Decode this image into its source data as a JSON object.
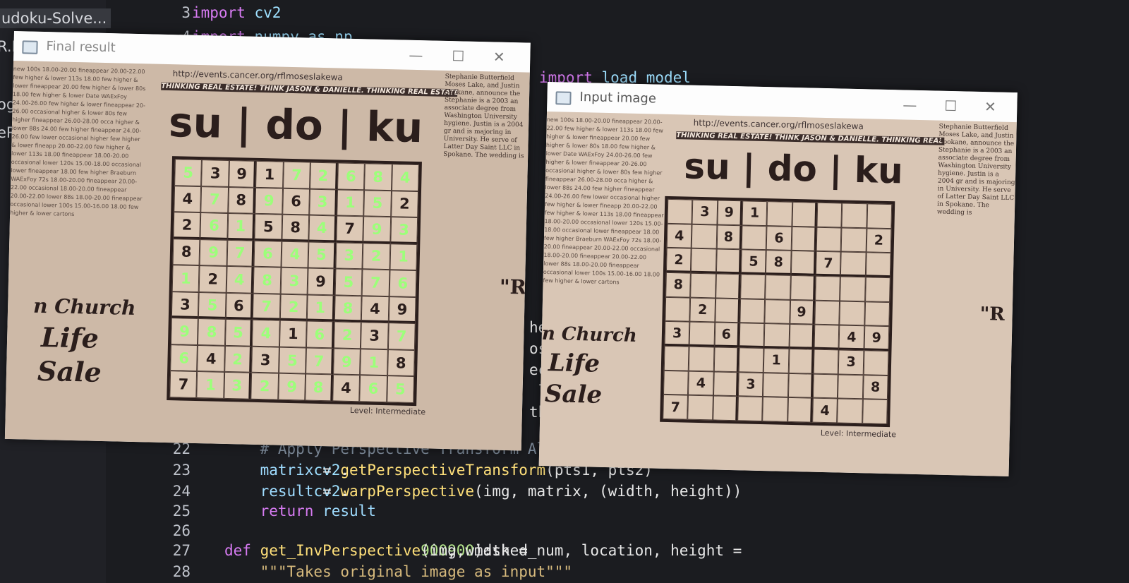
{
  "explorer": {
    "items": [
      "udoku-Solve...",
      "R.H",
      "og",
      "eRu"
    ]
  },
  "code_lines": [
    {
      "n": "3",
      "parts": [
        [
          "kw",
          "import "
        ],
        [
          "mod",
          "cv2"
        ]
      ]
    },
    {
      "n": "4",
      "parts": [
        [
          "kw",
          "import "
        ],
        [
          "mod",
          "numpy as np"
        ]
      ]
    },
    {
      "n": "",
      "parts": [
        [
          "kw",
          "import "
        ],
        [
          "mod",
          "load_model"
        ]
      ]
    },
    {
      "n": "",
      "parts": [
        [
          "code",
          "hei"
        ]
      ]
    },
    {
      "n": "",
      "parts": [
        [
          "code",
          "os"
        ]
      ]
    },
    {
      "n": "",
      "parts": [
        [
          "code",
          "ect"
        ]
      ]
    },
    {
      "n": "",
      "parts": [
        [
          "code",
          " lo"
        ]
      ]
    },
    {
      "n": "",
      "parts": [
        [
          "code",
          "th"
        ]
      ]
    },
    {
      "n": "22",
      "parts": [
        [
          "cm",
          "    # Apply Perspective Transform Algorithm"
        ]
      ]
    },
    {
      "n": "23",
      "parts": [
        [
          "var",
          "    matrix"
        ],
        [
          "code",
          " = "
        ],
        [
          "mod",
          "cv2"
        ],
        [
          "code",
          "."
        ],
        [
          "fn",
          "getPerspectiveTransform"
        ],
        [
          "code",
          "(pts1, pts2)"
        ]
      ]
    },
    {
      "n": "24",
      "parts": [
        [
          "var",
          "    result"
        ],
        [
          "code",
          " = "
        ],
        [
          "mod",
          "cv2"
        ],
        [
          "code",
          "."
        ],
        [
          "fn",
          "warpPerspective"
        ],
        [
          "code",
          "(img, matrix, (width, height))"
        ]
      ]
    },
    {
      "n": "25",
      "parts": [
        [
          "kw",
          "    return "
        ],
        [
          "var",
          "result"
        ]
      ]
    },
    {
      "n": "26",
      "parts": [
        [
          "code",
          ""
        ]
      ]
    },
    {
      "n": "27",
      "parts": [
        [
          "kw",
          "def "
        ],
        [
          "fn",
          "get_InvPerspective"
        ],
        [
          "code",
          "(img, masked_num, location, height = "
        ],
        [
          "num",
          "900"
        ],
        [
          "code",
          ", width = "
        ],
        [
          "num",
          "900"
        ],
        [
          "code",
          "):"
        ]
      ]
    },
    {
      "n": "28",
      "parts": [
        [
          "str",
          "    \"\"\"Takes original image as input\"\"\""
        ]
      ]
    }
  ],
  "final_window": {
    "title": "Final result",
    "url": "http://events.cancer.org/rflmoseslakewa",
    "banner": "THINKING REAL ESTATE! THINK JASON & DANIELLE. THINKING REAL ESTATE! THINK",
    "logo": "su | do | ku",
    "level": "Level: Intermediate",
    "church": [
      "n Church",
      "Life",
      "Sale"
    ],
    "side_text": "Stephanie Butterfield Moses Lake, and Justin Spokane, announce the Stephanie is a 2003 an associate degree from Washington University hygiene. Justin is a 2004 gr and is majoring in University. He serve of Latter Day Saint LLC in Spokane. The wedding is",
    "quote": "\"R",
    "rows": [
      [
        "5g",
        "3",
        "9",
        "1",
        "7g",
        "2g",
        "6g",
        "8g",
        "4g"
      ],
      [
        "4",
        "7g",
        "8",
        "9g",
        "6",
        "3g",
        "1g",
        "5g",
        "2"
      ],
      [
        "2",
        "6g",
        "1g",
        "5",
        "8",
        "4g",
        "7",
        "9g",
        "3g"
      ],
      [
        "8",
        "9g",
        "7g",
        "6g",
        "4g",
        "5g",
        "3g",
        "2g",
        "1g"
      ],
      [
        "1g",
        "2",
        "4g",
        "8g",
        "3g",
        "9",
        "5g",
        "7g",
        "6g"
      ],
      [
        "3",
        "5g",
        "6",
        "7g",
        "2g",
        "1g",
        "8g",
        "4",
        "9"
      ],
      [
        "9g",
        "8g",
        "5g",
        "4g",
        "1",
        "6g",
        "2g",
        "3",
        "7g"
      ],
      [
        "6g",
        "4",
        "2g",
        "3",
        "5g",
        "7g",
        "9g",
        "1g",
        "8"
      ],
      [
        "7",
        "1g",
        "3g",
        "2g",
        "9g",
        "8g",
        "4",
        "6g",
        "5g"
      ]
    ]
  },
  "input_window": {
    "title": "Input image",
    "url": "http://events.cancer.org/rflmoseslakewa",
    "banner": "THINKING REAL ESTATE! THINK JASON & DANIELLE. THINKING REAL ESTATE! THINK",
    "logo": "su | do | ku",
    "level": "Level: Intermediate",
    "church": [
      "n Church",
      "Life",
      "Sale"
    ],
    "side_text": "Stephanie Butterfield Moses Lake, and Justin Spokane, announce the Stephanie is a 2003 an associate degree from Washington University hygiene. Justin is a 2004 gr and is majoring in University. He serve of Latter Day Saint LLC in Spokane. The wedding is",
    "quote": "\"R",
    "rows": [
      [
        "",
        "3",
        "9",
        "1",
        "",
        "",
        "",
        "",
        ""
      ],
      [
        "4",
        "",
        "8",
        "",
        "6",
        "",
        "",
        "",
        "2"
      ],
      [
        "2",
        "",
        "",
        "5",
        "8",
        "",
        "7",
        "",
        ""
      ],
      [
        "8",
        "",
        "",
        "",
        "",
        "",
        "",
        "",
        ""
      ],
      [
        "",
        "2",
        "",
        "",
        "",
        "9",
        "",
        "",
        ""
      ],
      [
        "3",
        "",
        "6",
        "",
        "",
        "",
        "",
        "4",
        "9"
      ],
      [
        "",
        "",
        "",
        "",
        "1",
        "",
        "",
        "3",
        ""
      ],
      [
        "",
        "4",
        "",
        "3",
        "",
        "",
        "",
        "",
        "8"
      ],
      [
        "7",
        "",
        "",
        "",
        "",
        "",
        "4",
        "",
        ""
      ]
    ]
  },
  "newsprint": "new 100s 18.00-20.00 fineappear 20.00-22.00 few higher & lower 113s 18.00 few higher & lower fineappear 20.00 few higher & lower 80s 18.00 few higher & lower Date WAExFoy 24.00-26.00 few higher & lower fineappear 20-26.00 occasional higher & lower 80s few higher fineappear 26.00-28.00 occa higher & lower 88s 24.00 few higher fineappear 24.00-26.00 few lower occasional higher few higher & lower fineapp 20.00-22.00 few higher & lower 113s 18.00 fineappear 18.00-20.00 occasional lower 120s 15.00-18.00 occasional lower fineappear 18.00 few higher Braeburn WAExFoy 72s 18.00-20.00 fineappear 20.00-22.00 occasional 18.00-20.00 fineappear 20.00-22.00 lower 88s 18.00-20.00 fineappear occasional lower 100s 15.00-16.00 18.00 few higher & lower cartons",
  "colors": {
    "solved_digit": "#9cff7a",
    "paper": "#cdb9a7",
    "ink": "#2b1e1c"
  }
}
